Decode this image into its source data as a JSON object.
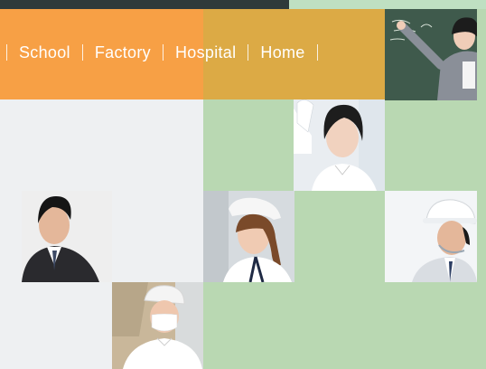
{
  "nav": {
    "items": [
      {
        "label": "School"
      },
      {
        "label": "Factory"
      },
      {
        "label": "Hospital"
      },
      {
        "label": "Home"
      }
    ]
  },
  "colors": {
    "nav_orange": "#f7a045",
    "nav_gold": "#dcaa45",
    "background_green": "#b9d8b2",
    "background_grey": "#eef0f2",
    "nav_text": "#ffffff"
  },
  "photos": [
    {
      "name": "teacher-at-chalkboard-photo"
    },
    {
      "name": "lab-scientist-photo"
    },
    {
      "name": "businessman-photo"
    },
    {
      "name": "nurse-photo"
    },
    {
      "name": "hardhat-worker-photo"
    },
    {
      "name": "masked-factory-worker-photo"
    }
  ]
}
